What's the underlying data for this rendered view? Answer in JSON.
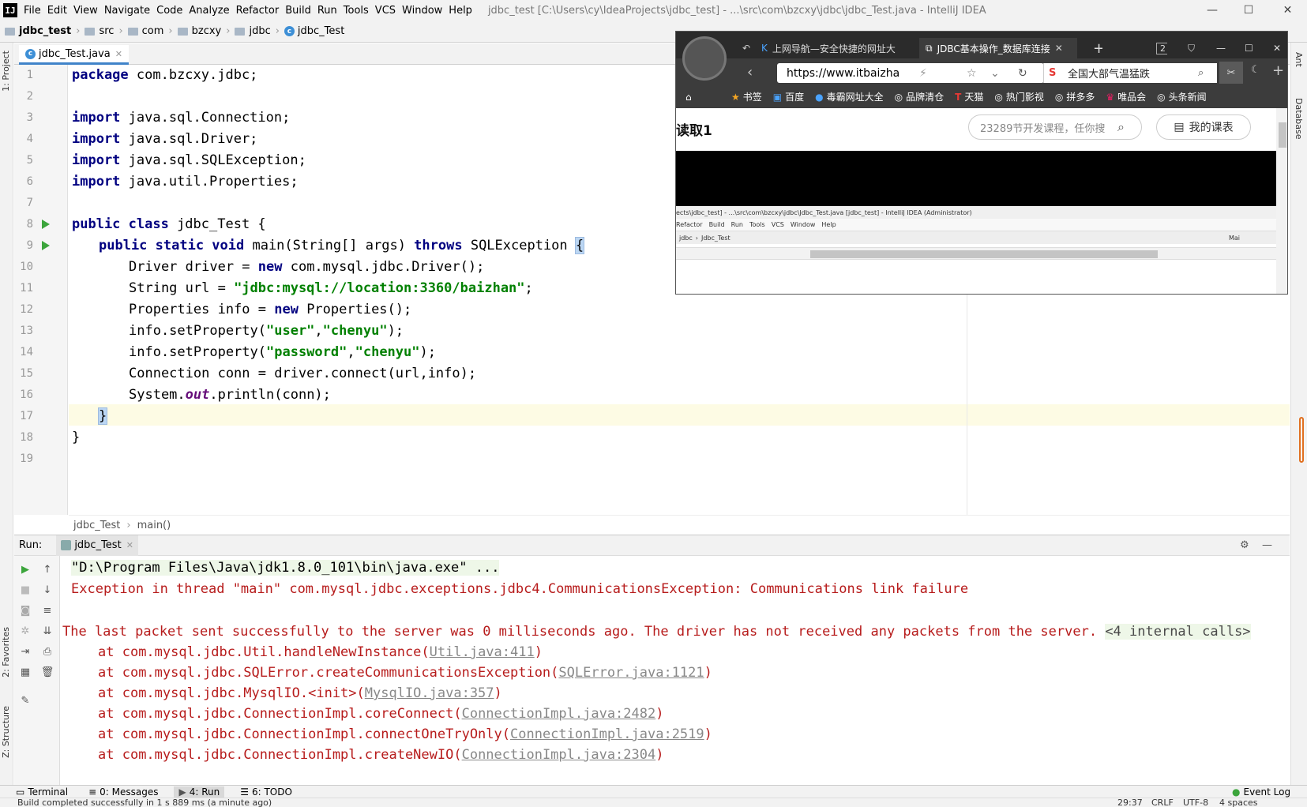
{
  "app": {
    "menu": [
      "File",
      "Edit",
      "View",
      "Navigate",
      "Code",
      "Analyze",
      "Refactor",
      "Build",
      "Run",
      "Tools",
      "VCS",
      "Window",
      "Help"
    ],
    "window_title": "jdbc_test [C:\\Users\\cy\\IdeaProjects\\jdbc_test] - ...\\src\\com\\bzcxy\\jdbc\\jdbc_Test.java - IntelliJ IDEA"
  },
  "breadcrumb": [
    "jdbc_test",
    "src",
    "com",
    "bzcxy",
    "jdbc",
    "jdbc_Test"
  ],
  "left_panels": [
    "1: Project",
    "2: Favorites",
    "Z: Structure"
  ],
  "right_panels": [
    "Ant",
    "Database"
  ],
  "editor": {
    "tab": "jdbc_Test.java",
    "line_numbers": [
      "1",
      "2",
      "3",
      "4",
      "5",
      "6",
      "7",
      "8",
      "9",
      "10",
      "11",
      "12",
      "13",
      "14",
      "15",
      "16",
      "17",
      "18",
      "19"
    ],
    "breadcrumb": [
      "jdbc_Test",
      "main()"
    ],
    "code": {
      "l1_kw": "package",
      "l1_rest": " com.bzcxy.jdbc;",
      "import_kw": "import",
      "l3": " java.sql.Connection;",
      "l4": " java.sql.Driver;",
      "l5": " java.sql.SQLException;",
      "l6": " java.util.Properties;",
      "l8_kw": "public class",
      "l8_rest": " jdbc_Test {",
      "l9_kw1": "public static void",
      "l9_mid": " main(String[] args) ",
      "l9_kw2": "throws",
      "l9_rest": " SQLException ",
      "l9_brace": "{",
      "l10_a": "Driver driver = ",
      "new_kw": "new",
      "l10_b": " com.mysql.jdbc.Driver();",
      "l11_a": "String url = ",
      "l11_str": "\"jdbc:mysql://location:3360/baizhan\"",
      "l11_b": ";",
      "l12_a": "Properties info = ",
      "l12_b": " Properties();",
      "l13_a": "info.setProperty(",
      "l13_s1": "\"user\"",
      "comma": ",",
      "l13_s2": "\"chenyu\"",
      "close": ");",
      "l14_s1": "\"password\"",
      "l15": "Connection conn = driver.connect(url,info);",
      "l16_a": "System.",
      "l16_fld": "out",
      "l16_b": ".println(conn);",
      "l17": "}",
      "l18": "}"
    }
  },
  "run": {
    "label": "Run:",
    "tab": "jdbc_Test",
    "cmd": "\"D:\\Program Files\\Java\\jdk1.8.0_101\\bin\\java.exe\" ...",
    "exception": "Exception in thread \"main\" com.mysql.jdbc.exceptions.jdbc4.CommunicationsException: Communications link failure",
    "packet_msg": "The last packet sent successfully to the server was 0 milliseconds ago. The driver has not received any packets from the server. ",
    "internal_calls": "<4 internal calls>",
    "at": "at ",
    "stack": [
      {
        "method": "com.mysql.jdbc.Util.handleNewInstance(",
        "link": "Util.java:411"
      },
      {
        "method": "com.mysql.jdbc.SQLError.createCommunicationsException(",
        "link": "SQLError.java:1121"
      },
      {
        "method": "com.mysql.jdbc.MysqlIO.<init>(",
        "link": "MysqlIO.java:357"
      },
      {
        "method": "com.mysql.jdbc.ConnectionImpl.coreConnect(",
        "link": "ConnectionImpl.java:2482"
      },
      {
        "method": "com.mysql.jdbc.ConnectionImpl.connectOneTryOnly(",
        "link": "ConnectionImpl.java:2519"
      },
      {
        "method": "com.mysql.jdbc.ConnectionImpl.createNewIO(",
        "link": "ConnectionImpl.java:2304"
      }
    ],
    "paren_close": ")"
  },
  "bottom_tabs": [
    "Terminal",
    "0: Messages",
    "4: Run",
    "6: TODO"
  ],
  "event_log": "Event Log",
  "status": {
    "message": "Build completed successfully in 1 s 889 ms (a minute ago)",
    "position": "29:37",
    "line_sep": "CRLF",
    "encoding": "UTF-8",
    "indent": "4 spaces"
  },
  "browser": {
    "tab_count": "2",
    "tabs": [
      "上网导航—安全快捷的网址大",
      "JDBC基本操作_数据库连接"
    ],
    "url": "https://www.itbaizha",
    "search": "全国大部气温猛跌",
    "bookmarks": [
      "书签",
      "百度",
      "毒霸网址大全",
      "品牌清仓",
      "天猫",
      "热门影视",
      "拼多多",
      "唯品会",
      "头条新闻"
    ],
    "page": {
      "heading": "读取1",
      "search_placeholder": "23289节开发课程，任你搜",
      "courses_button": "我的课表",
      "mini_title": "ects\\jdbc_test] - ...\\src\\com\\bzcxy\\jdbc\\Jdbc_Test.java [jdbc_test] - IntelliJ IDEA (Administrator)",
      "mini_menu": [
        "Refactor",
        "Build",
        "Run",
        "Tools",
        "VCS",
        "Window",
        "Help"
      ],
      "mini_nav": [
        "jdbc",
        "Jdbc_Test"
      ],
      "mini_main": "Mai"
    }
  },
  "colors": {
    "keyword": "#000080",
    "string": "#008000",
    "error": "#b71c1c",
    "run_green": "#3ca53c",
    "caret_line": "#fdfbe4",
    "tab_accent": "#4083c9"
  }
}
